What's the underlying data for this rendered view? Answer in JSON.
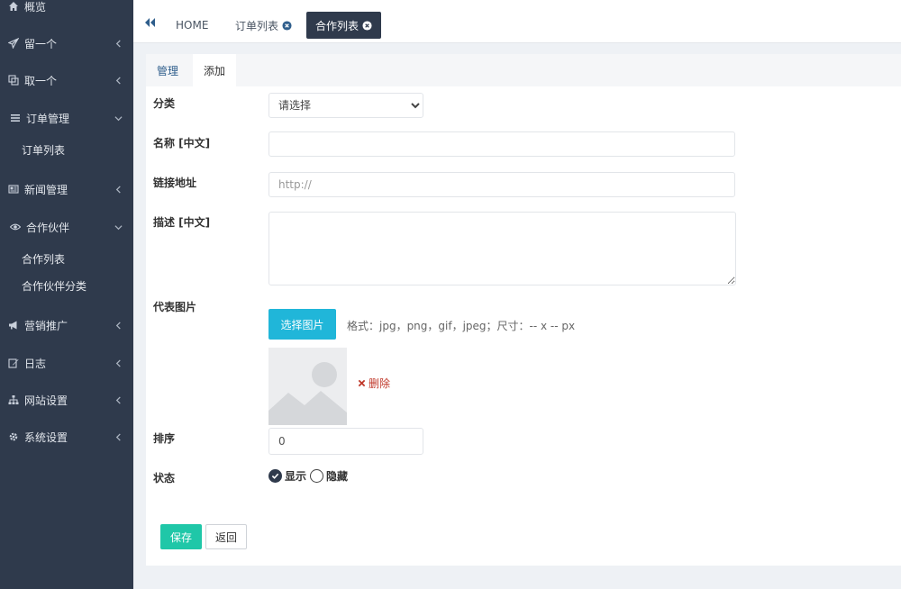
{
  "sidebar": {
    "items": [
      {
        "label": "概览",
        "icon": "home-icon"
      },
      {
        "label": "留一个",
        "icon": "send-icon"
      },
      {
        "label": "取一个",
        "icon": "copy-icon"
      },
      {
        "label": "订单管理",
        "icon": "list-icon"
      },
      {
        "label": "新闻管理",
        "icon": "newspaper-icon"
      },
      {
        "label": "合作伙伴",
        "icon": "eye-icon"
      },
      {
        "label": "营销推广",
        "icon": "bullhorn-icon"
      },
      {
        "label": "日志",
        "icon": "edit-icon"
      },
      {
        "label": "网站设置",
        "icon": "sitemap-icon"
      },
      {
        "label": "系统设置",
        "icon": "gear-icon"
      }
    ],
    "order_sub": [
      "订单列表"
    ],
    "partner_sub": [
      "合作列表",
      "合作伙伴分类"
    ]
  },
  "tabs": [
    {
      "label": "HOME"
    },
    {
      "label": "订单列表"
    },
    {
      "label": "合作列表"
    }
  ],
  "subtabs": [
    "管理",
    "添加"
  ],
  "form": {
    "category_label": "分类",
    "category_value": "请选择",
    "name_label": "名称 [中文]",
    "name_value": "",
    "link_label": "链接地址",
    "link_placeholder": "http://",
    "desc_label": "描述 [中文]",
    "desc_value": "",
    "image_label": "代表图片",
    "choose_image": "选择图片",
    "format_hint": "格式：jpg，png，gif，jpeg；尺寸：-- x -- px",
    "delete_label": "删除",
    "sort_label": "排序",
    "sort_value": "0",
    "status_label": "状态",
    "status_show": "显示",
    "status_hide": "隐藏"
  },
  "footer": {
    "save": "保存",
    "back": "返回"
  },
  "colors": {
    "sidebar_bg": "#2f3a4c",
    "choose_btn": "#20b6d9",
    "save_btn": "#1fc7a8",
    "delete": "#c0392b"
  }
}
